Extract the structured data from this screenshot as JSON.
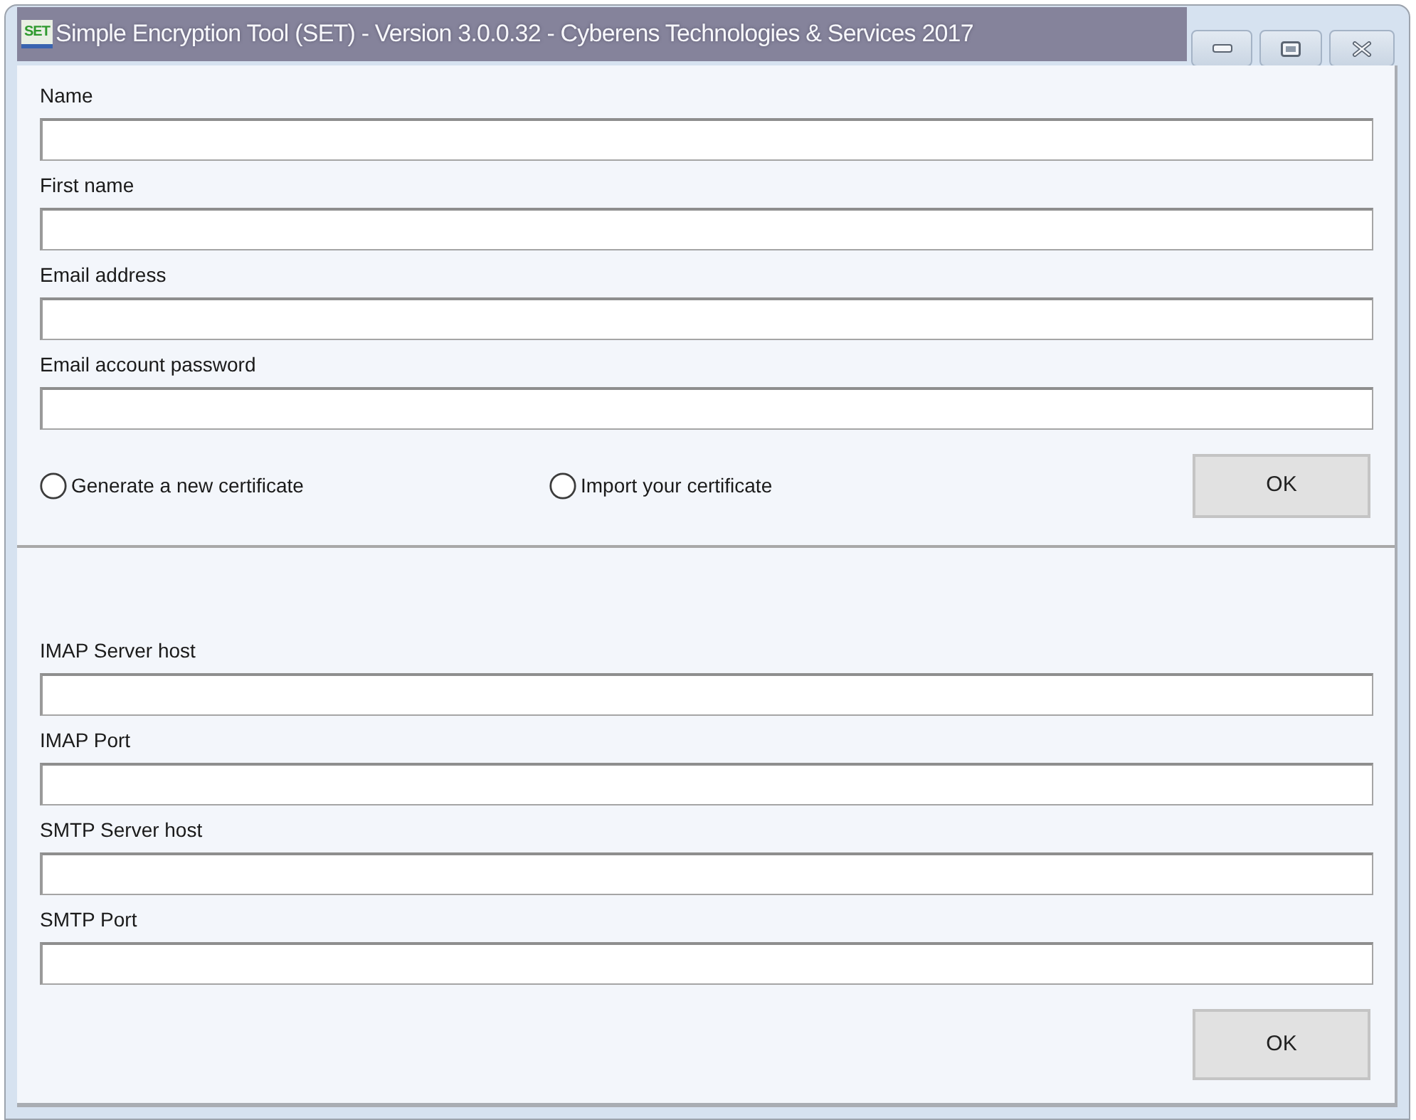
{
  "window": {
    "title": "Simple Encryption Tool (SET) - Version 3.0.0.32 - Cyberens Technologies & Services 2017",
    "logo_text": "SET"
  },
  "account": {
    "fields": [
      {
        "label": "Name"
      },
      {
        "label": "First name"
      },
      {
        "label": "Email address"
      },
      {
        "label": "Email account password"
      }
    ],
    "certificate_options": [
      {
        "label": "Generate a new certificate",
        "selected": false
      },
      {
        "label": "Import your certificate",
        "selected": false
      }
    ],
    "button": "OK"
  },
  "server": {
    "fields": [
      {
        "label": "IMAP Server host"
      },
      {
        "label": "IMAP Port"
      },
      {
        "label": "SMTP Server host"
      },
      {
        "label": "SMTP Port"
      }
    ],
    "button": "OK"
  }
}
